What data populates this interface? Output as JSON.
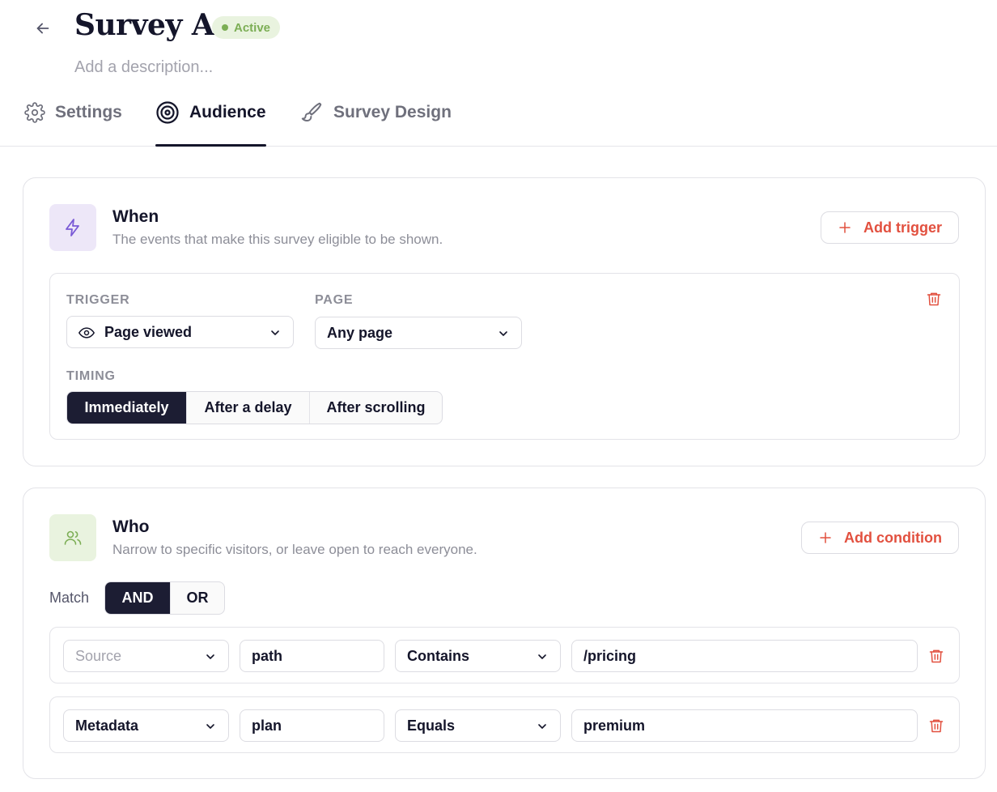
{
  "header": {
    "title": "Survey A",
    "status": "Active",
    "description_placeholder": "Add a description..."
  },
  "tabs": [
    {
      "label": "Settings",
      "icon": "gear-icon",
      "active": false
    },
    {
      "label": "Audience",
      "icon": "target-icon",
      "active": true
    },
    {
      "label": "Survey Design",
      "icon": "brush-icon",
      "active": false
    }
  ],
  "when": {
    "title": "When",
    "subtitle": "The events that make this survey eligible to be shown.",
    "add_label": "Add trigger",
    "trigger_label": "TRIGGER",
    "trigger_value": "Page viewed",
    "page_label": "PAGE",
    "page_value": "Any page",
    "timing_label": "TIMING",
    "timing_options": [
      "Immediately",
      "After a delay",
      "After scrolling"
    ],
    "timing_selected": "Immediately"
  },
  "who": {
    "title": "Who",
    "subtitle": "Narrow to specific visitors, or leave open to reach everyone.",
    "add_label": "Add condition",
    "match_label": "Match",
    "match_options": [
      "AND",
      "OR"
    ],
    "match_selected": "AND",
    "conditions": [
      {
        "source": "Source",
        "source_is_placeholder": true,
        "field": "path",
        "operator": "Contains",
        "value": "/pricing"
      },
      {
        "source": "Metadata",
        "source_is_placeholder": false,
        "field": "plan",
        "operator": "Equals",
        "value": "premium"
      }
    ]
  },
  "colors": {
    "accent_red": "#e2503f",
    "active_green": "#7cae55",
    "dark": "#1c1d33",
    "when_icon_bg": "#ede7f8",
    "who_icon_bg": "#e9f3df"
  }
}
